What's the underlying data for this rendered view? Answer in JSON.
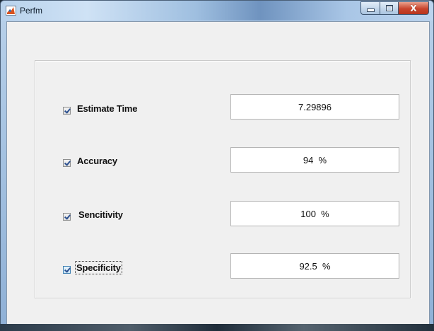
{
  "window": {
    "title": "Perfm",
    "app_icon": "matlab-icon",
    "caption_buttons": [
      "minimize-icon",
      "maximize-icon",
      "close-icon"
    ],
    "close_glyph": "X"
  },
  "fields": [
    {
      "label": "Estimate Time",
      "checked": true,
      "value": "7.29896"
    },
    {
      "label": "Accuracy",
      "checked": true,
      "value": "94  %"
    },
    {
      "label": "Sencitivity",
      "checked": true,
      "value": "100  %"
    },
    {
      "label": "Specificity",
      "checked": true,
      "focused": true,
      "value": "92.5  %"
    }
  ],
  "colors": {
    "client_background": "#f0f0f0",
    "close_button": "#c8452d",
    "checkmark": "#2a4f8f"
  }
}
